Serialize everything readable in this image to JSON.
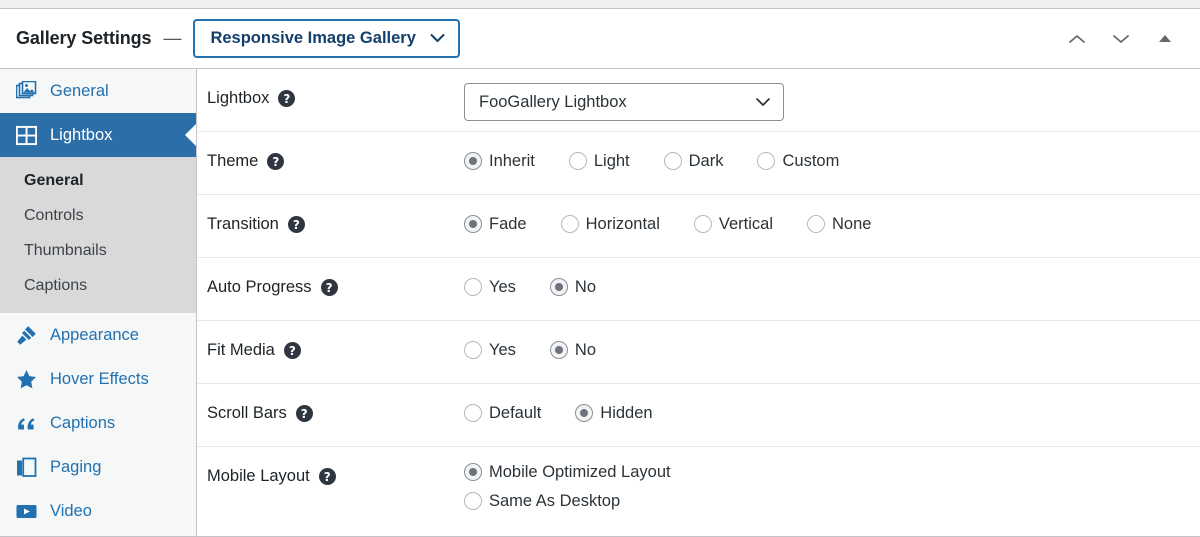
{
  "header": {
    "title": "Gallery Settings",
    "separator": "—",
    "template_name": "Responsive Image Gallery",
    "actions": [
      {
        "name": "move-up",
        "icon": "chevron-up-icon"
      },
      {
        "name": "move-down",
        "icon": "chevron-down-icon"
      },
      {
        "name": "collapse",
        "icon": "triangle-up-icon"
      }
    ]
  },
  "sidebar": {
    "items": [
      {
        "label": "General",
        "icon": "images-stack-icon",
        "active": false
      },
      {
        "label": "Lightbox",
        "icon": "grid-icon",
        "active": true
      },
      {
        "label": "Appearance",
        "icon": "paintbrush-icon",
        "active": false
      },
      {
        "label": "Hover Effects",
        "icon": "star-icon",
        "active": false
      },
      {
        "label": "Captions",
        "icon": "quote-icon",
        "active": false
      },
      {
        "label": "Paging",
        "icon": "book-icon",
        "active": false
      },
      {
        "label": "Video",
        "icon": "play-icon",
        "active": false
      }
    ],
    "subitems": [
      {
        "label": "General",
        "current": true
      },
      {
        "label": "Controls",
        "current": false
      },
      {
        "label": "Thumbnails",
        "current": false
      },
      {
        "label": "Captions",
        "current": false
      }
    ]
  },
  "settings": [
    {
      "label": "Lightbox",
      "help": "?",
      "type": "select",
      "value": "FooGallery Lightbox"
    },
    {
      "label": "Theme",
      "help": "?",
      "type": "radio",
      "options": [
        {
          "label": "Inherit",
          "checked": true
        },
        {
          "label": "Light",
          "checked": false
        },
        {
          "label": "Dark",
          "checked": false
        },
        {
          "label": "Custom",
          "checked": false
        }
      ]
    },
    {
      "label": "Transition",
      "help": "?",
      "type": "radio",
      "options": [
        {
          "label": "Fade",
          "checked": true
        },
        {
          "label": "Horizontal",
          "checked": false
        },
        {
          "label": "Vertical",
          "checked": false
        },
        {
          "label": "None",
          "checked": false
        }
      ]
    },
    {
      "label": "Auto Progress",
      "help": "?",
      "type": "radio",
      "options": [
        {
          "label": "Yes",
          "checked": false
        },
        {
          "label": "No",
          "checked": true
        }
      ]
    },
    {
      "label": "Fit Media",
      "help": "?",
      "type": "radio",
      "options": [
        {
          "label": "Yes",
          "checked": false
        },
        {
          "label": "No",
          "checked": true
        }
      ]
    },
    {
      "label": "Scroll Bars",
      "help": "?",
      "type": "radio",
      "options": [
        {
          "label": "Default",
          "checked": false
        },
        {
          "label": "Hidden",
          "checked": true
        }
      ]
    },
    {
      "label": "Mobile Layout",
      "help": "?",
      "type": "radio",
      "vertical": true,
      "options": [
        {
          "label": "Mobile Optimized Layout",
          "checked": true
        },
        {
          "label": "Same As Desktop",
          "checked": false
        }
      ]
    }
  ],
  "colors": {
    "accent": "#2271b1",
    "active_nav": "#2c6fa8",
    "help_bg": "#2f3641"
  }
}
